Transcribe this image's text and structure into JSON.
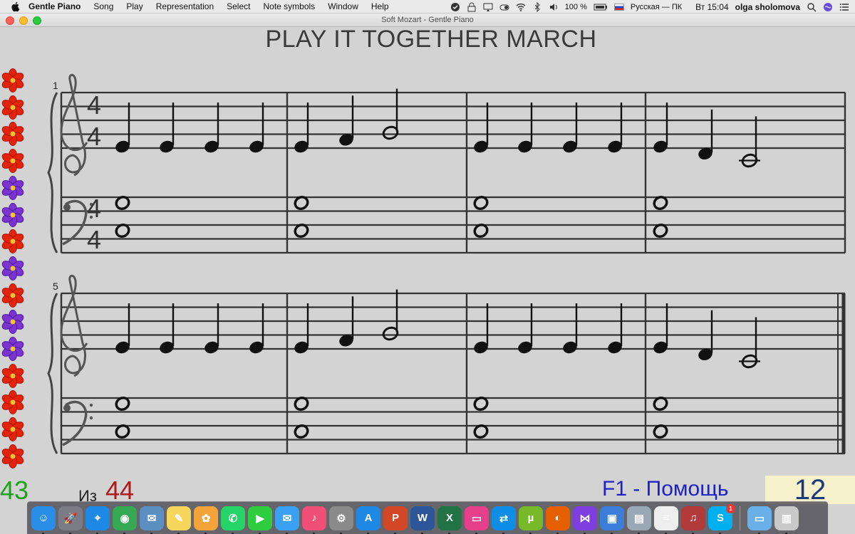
{
  "menubar": {
    "items": [
      "Gentle Piano",
      "Song",
      "Play",
      "Representation",
      "Select",
      "Note symbols",
      "Window",
      "Help"
    ],
    "battery": "100 %",
    "keyboard": "Русская — ПК",
    "clock": "Вт 15:04",
    "user": "olga sholomova"
  },
  "window": {
    "title": "Soft Mozart - Gentle Piano"
  },
  "song": {
    "title": "PLAY IT TOGETHER MARCH"
  },
  "score": {
    "systems": [
      {
        "measure_number": "1",
        "time_signature": [
          "4",
          "4"
        ]
      },
      {
        "measure_number": "5",
        "time_signature": null
      }
    ]
  },
  "status": {
    "current": "43",
    "of_label": "Из",
    "total": "44",
    "help_hint": "F1 - Помощь",
    "score_value": "12",
    "current_color": "#1aa31a",
    "total_color": "#b01a1a",
    "help_color": "#1d22c8"
  },
  "flowers": [
    "red",
    "red",
    "red",
    "red",
    "purple",
    "purple",
    "red",
    "purple",
    "red",
    "purple",
    "purple",
    "red",
    "red",
    "red",
    "red"
  ],
  "dock": {
    "apps": [
      {
        "name": "finder",
        "glyph": "☺",
        "color": "#2a8ee6"
      },
      {
        "name": "launchpad",
        "glyph": "🚀",
        "color": "#7b7b85"
      },
      {
        "name": "safari",
        "glyph": "⌖",
        "color": "#1e88e5"
      },
      {
        "name": "chrome",
        "glyph": "◉",
        "color": "#34a853"
      },
      {
        "name": "preview",
        "glyph": "✉",
        "color": "#5b8fc2"
      },
      {
        "name": "notes",
        "glyph": "✎",
        "color": "#f7d65a"
      },
      {
        "name": "photos",
        "glyph": "✿",
        "color": "#f2a33a"
      },
      {
        "name": "whatsapp",
        "glyph": "✆",
        "color": "#25d366"
      },
      {
        "name": "facetime",
        "glyph": "▶",
        "color": "#2ecc40"
      },
      {
        "name": "messages",
        "glyph": "✉",
        "color": "#3aa0f2"
      },
      {
        "name": "itunes",
        "glyph": "♪",
        "color": "#f04f77"
      },
      {
        "name": "system-preferences",
        "glyph": "⚙",
        "color": "#8a8a8a"
      },
      {
        "name": "app-store",
        "glyph": "A",
        "color": "#1e88e5"
      },
      {
        "name": "powerpoint",
        "glyph": "P",
        "color": "#d24726"
      },
      {
        "name": "word",
        "glyph": "W",
        "color": "#2b579a"
      },
      {
        "name": "excel",
        "glyph": "X",
        "color": "#217346"
      },
      {
        "name": "screen",
        "glyph": "▭",
        "color": "#e83f8a"
      },
      {
        "name": "teamviewer",
        "glyph": "⇄",
        "color": "#0e8ee9"
      },
      {
        "name": "utorrent",
        "glyph": "µ",
        "color": "#78b92a"
      },
      {
        "name": "firefox",
        "glyph": "◐",
        "color": "#e66000"
      },
      {
        "name": "visual-studio",
        "glyph": "⋈",
        "color": "#7e3ee0"
      },
      {
        "name": "ssd-utility",
        "glyph": "▣",
        "color": "#3b7dd8"
      },
      {
        "name": "image-capture",
        "glyph": "▤",
        "color": "#9aa7b5"
      },
      {
        "name": "textedit",
        "glyph": "≡",
        "color": "#eeeeee"
      },
      {
        "name": "gentle-piano",
        "glyph": "♫",
        "color": "#b23a3a"
      },
      {
        "name": "skype",
        "glyph": "S",
        "color": "#00aff0",
        "badge": "1"
      }
    ],
    "trailing": [
      {
        "name": "downloads-folder",
        "glyph": "▭",
        "color": "#6ab0e8"
      },
      {
        "name": "trash",
        "glyph": "▥",
        "color": "#c9c9c9"
      }
    ]
  }
}
